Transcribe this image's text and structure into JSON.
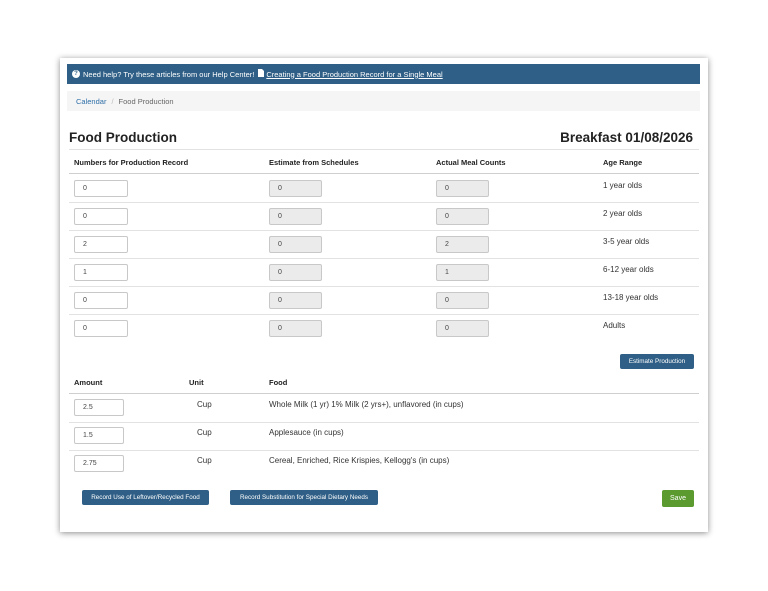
{
  "help": {
    "text": "Need help? Try these articles from our Help Center!",
    "link": "Creating a Food Production Record for a Single Meal"
  },
  "breadcrumb": {
    "calendar": "Calendar",
    "current": "Food Production"
  },
  "title": "Food Production",
  "meal": "Breakfast 01/08/2026",
  "production_table": {
    "headers": [
      "Numbers for Production Record",
      "Estimate from Schedules",
      "Actual Meal Counts",
      "Age Range"
    ],
    "rows": [
      {
        "numbers": "0",
        "estimate": "0",
        "actual": "0",
        "age": "1 year olds"
      },
      {
        "numbers": "0",
        "estimate": "0",
        "actual": "0",
        "age": "2 year olds"
      },
      {
        "numbers": "2",
        "estimate": "0",
        "actual": "2",
        "age": "3-5 year olds"
      },
      {
        "numbers": "1",
        "estimate": "0",
        "actual": "1",
        "age": "6-12 year olds"
      },
      {
        "numbers": "0",
        "estimate": "0",
        "actual": "0",
        "age": "13-18 year olds"
      },
      {
        "numbers": "0",
        "estimate": "0",
        "actual": "0",
        "age": "Adults"
      }
    ]
  },
  "estimate_button": "Estimate Production",
  "food_table": {
    "headers": [
      "Amount",
      "Unit",
      "Food"
    ],
    "rows": [
      {
        "amount": "2.5",
        "unit": "Cup",
        "food": "Whole Milk (1 yr) 1% Milk (2 yrs+), unflavored (in cups)"
      },
      {
        "amount": "1.5",
        "unit": "Cup",
        "food": "Applesauce (in cups)"
      },
      {
        "amount": "2.75",
        "unit": "Cup",
        "food": "Cereal, Enriched, Rice Krispies, Kellogg's (in cups)"
      }
    ]
  },
  "buttons": {
    "leftover": "Record Use of Leftover/Recycled Food",
    "substitution": "Record Substitution for Special Dietary Needs",
    "save": "Save"
  },
  "colors": {
    "header_bar": "#2f5f86",
    "primary_button": "#2f5f86",
    "save_button": "#5a9a2f",
    "link": "#2f6fa8"
  }
}
